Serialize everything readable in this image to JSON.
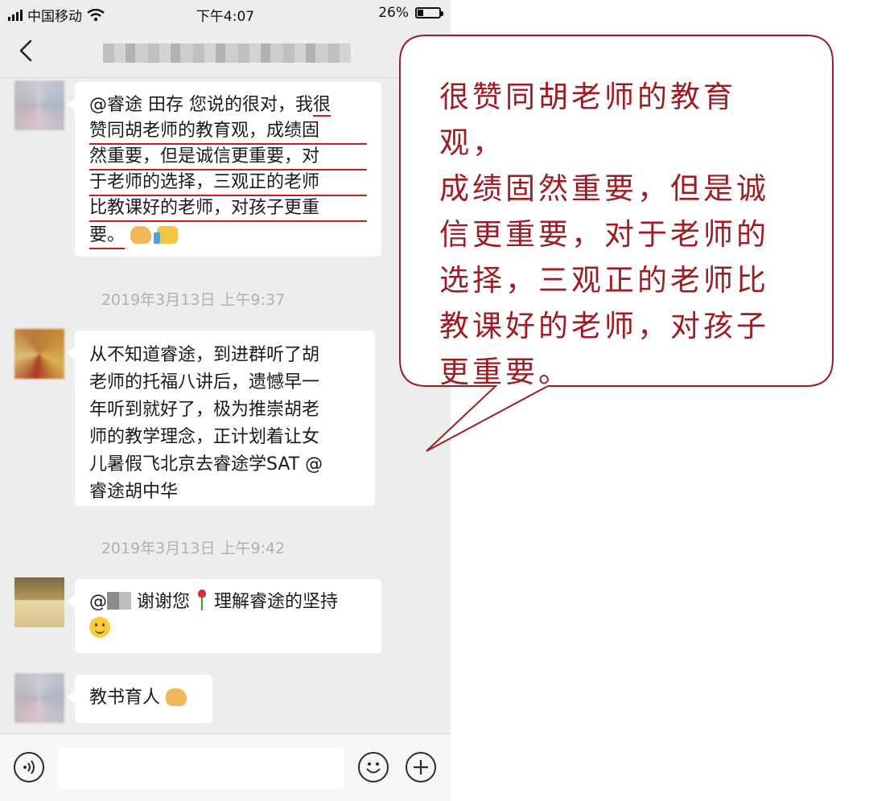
{
  "status_bar": {
    "carrier": "中国移动",
    "time": "下午4:07",
    "battery": "26%",
    "battery_level": 0.26
  },
  "chat": {
    "messages": [
      {
        "text_before": "@睿途 田存 您说的很对，我",
        "underlined_lines": [
          "很",
          "赞同胡老师的教育观，成绩固",
          "然重要，但是诚信更重要，对",
          "于老师的选择，三观正的老师",
          "比教课好的老师，对孩子更重",
          "要。"
        ],
        "emojis": [
          "handshake-emoji",
          "thumbs-up-emoji"
        ]
      },
      {
        "timestamp": "2019年3月13日 上午9:37",
        "lines": [
          "从不知道睿途，到进群听了胡",
          "老师的托福八讲后，遗憾早一",
          "年听到就好了，极为推崇胡老",
          "师的教学理念，正计划着让女",
          "儿暑假飞北京去睿途学SAT @",
          "睿途胡中华"
        ]
      },
      {
        "timestamp": "2019年3月13日 上午9:42",
        "text_prefix": "@",
        "text_mid": " 谢谢您",
        "text_after": "理解睿途的坚持",
        "emojis": [
          "rose-emoji",
          "smile-emoji"
        ]
      },
      {
        "text": "教书育人",
        "emojis": [
          "handshake-emoji"
        ]
      }
    ]
  },
  "callout": {
    "lines": [
      "很赞同胡老师的教育观，",
      "成绩固然重要，但是诚",
      "信更重要，对于老师的",
      "选择，三观正的老师比",
      "教课好的老师，对孩子",
      "更重要。"
    ],
    "color": "#9e1c24"
  },
  "colors": {
    "chat_background": "#ededed",
    "bubble": "#ffffff",
    "underline": "#c02020"
  }
}
